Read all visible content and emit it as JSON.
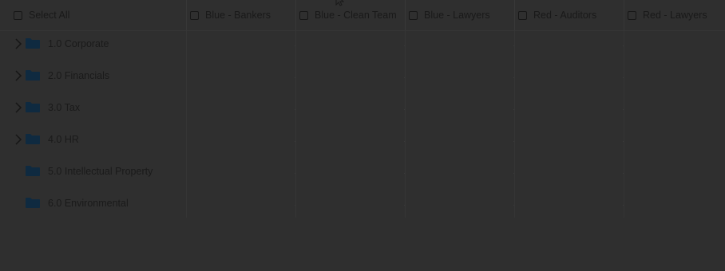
{
  "header": {
    "select_all_label": "Select All",
    "groups": [
      {
        "label": "Blue - Bankers",
        "checked": false
      },
      {
        "label": "Blue - Clean Team",
        "checked": false
      },
      {
        "label": "Blue - Lawyers",
        "checked": false
      },
      {
        "label": "Red - Auditors",
        "checked": false
      },
      {
        "label": "Red - Lawyers",
        "checked": false
      }
    ]
  },
  "folders": [
    {
      "label": "1.0 Corporate",
      "expandable": true
    },
    {
      "label": "2.0 Financials",
      "expandable": true
    },
    {
      "label": "3.0 Tax",
      "expandable": true
    },
    {
      "label": "4.0 HR",
      "expandable": true
    },
    {
      "label": "5.0 Intellectual Property",
      "expandable": false
    },
    {
      "label": "6.0 Environmental",
      "expandable": false
    }
  ],
  "colors": {
    "background": "#2f2f2f",
    "folder": "#0f2a40",
    "text": "#1b1b1b"
  },
  "icons": [
    "checkbox-icon",
    "chevron-right-icon",
    "folder-icon",
    "mouse-cursor-icon"
  ]
}
